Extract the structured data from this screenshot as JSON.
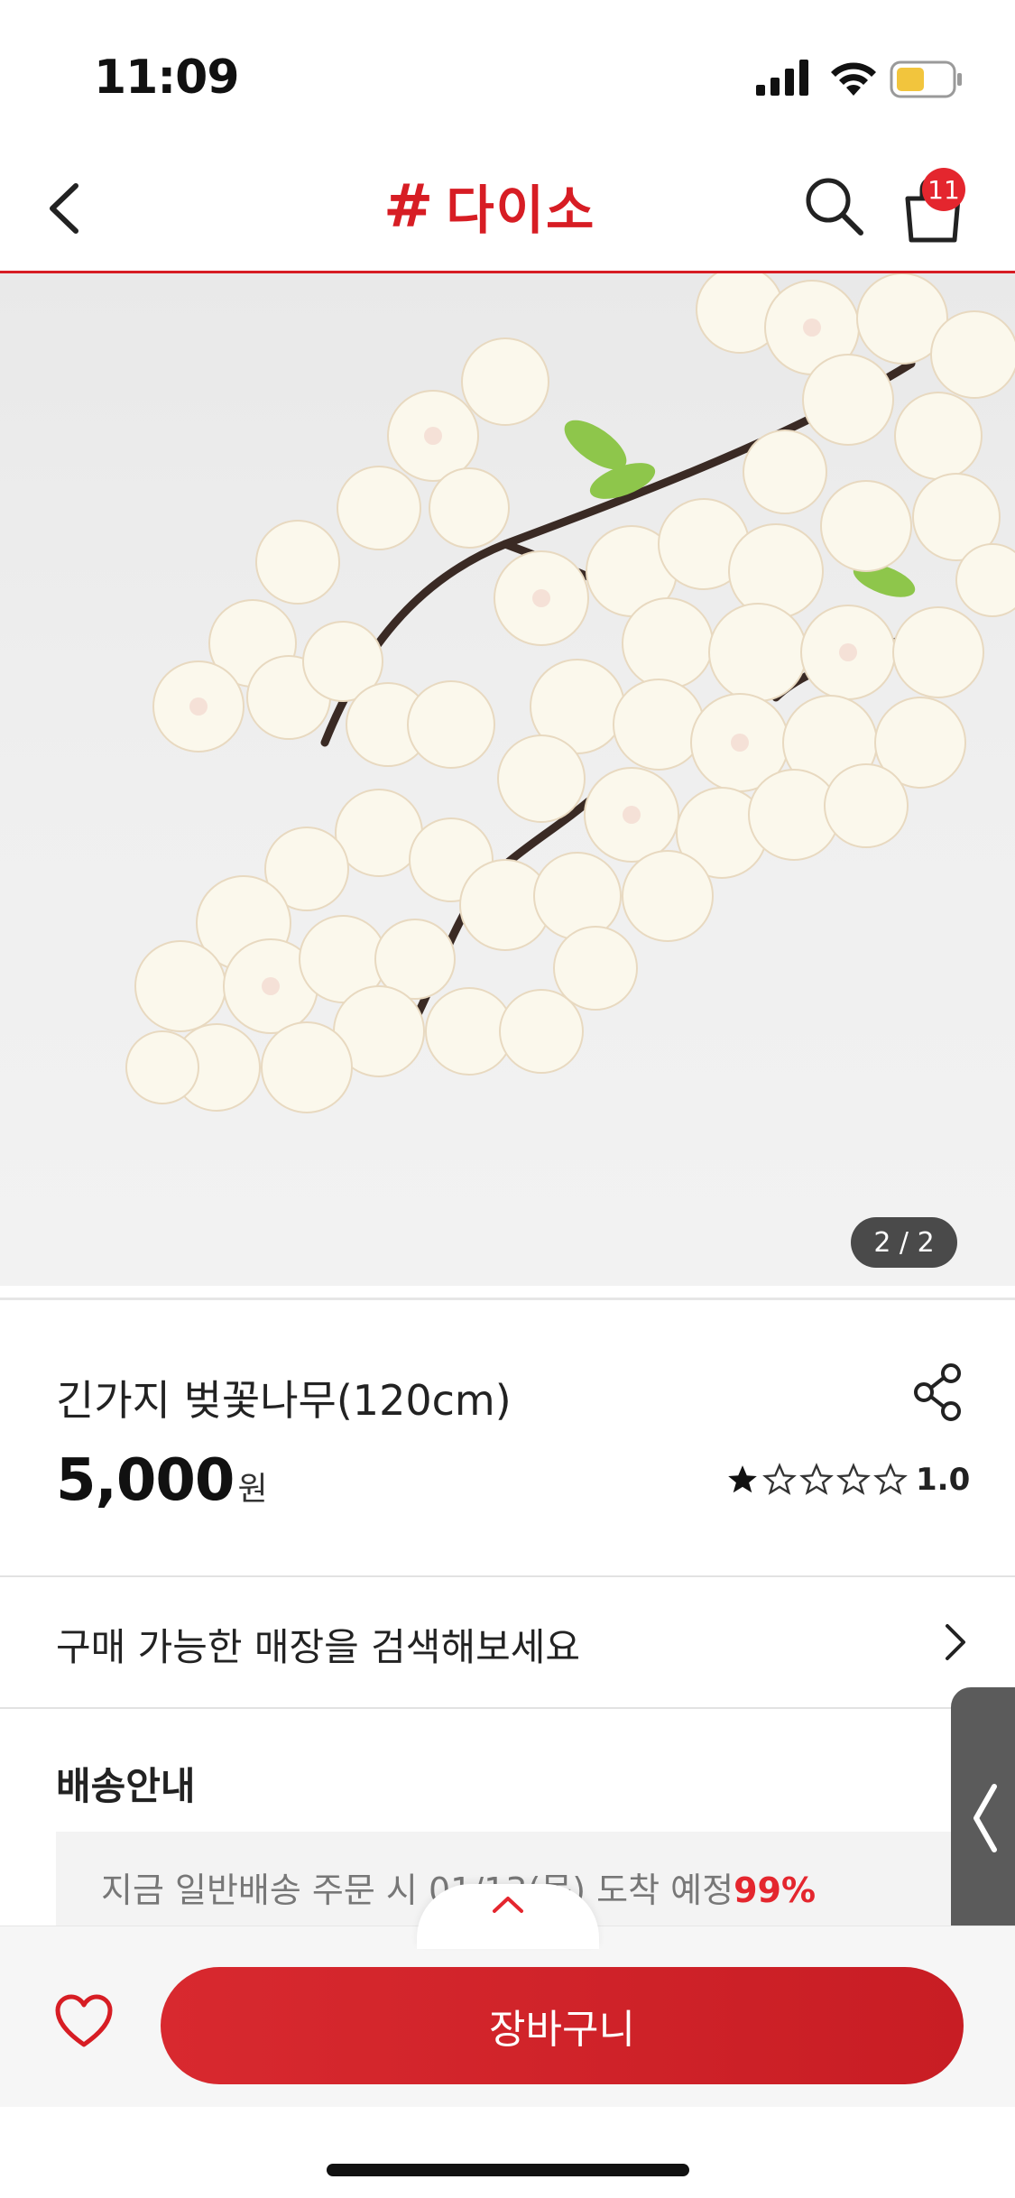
{
  "status_bar": {
    "time": "11:09"
  },
  "header": {
    "logo_hash": "#",
    "logo_text": "다이소",
    "cart_count": "11"
  },
  "product": {
    "image_counter": "2 / 2",
    "title": "긴가지 벚꽃나무(120cm)",
    "price": "5,000",
    "price_unit": "원",
    "rating_value": "1.0",
    "rating_stars_filled": 1,
    "rating_stars_total": 5
  },
  "store_search": {
    "label": "구매 가능한 매장을 검색해보세요"
  },
  "delivery": {
    "title": "배송안내",
    "text": "지금 일반배송 주문 시 01/13(목) 도착 예정",
    "percent": "99%"
  },
  "bottom_bar": {
    "cart_button_label": "장바구니"
  },
  "colors": {
    "brand": "#d71d24",
    "badge": "#e4262e",
    "counter_bg": "#4a4a4a"
  },
  "icons": [
    "back-icon",
    "search-icon",
    "cart-icon",
    "share-icon",
    "star-icon",
    "chevron-right-icon",
    "heart-icon",
    "chevron-up-icon",
    "chevron-left-icon"
  ]
}
